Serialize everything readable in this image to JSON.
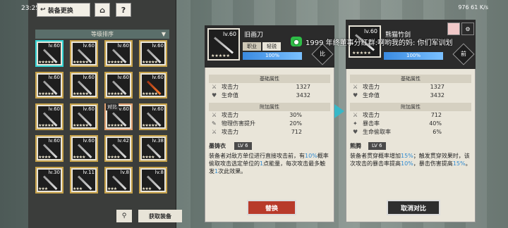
{
  "status": {
    "time": "23:25",
    "right_text": "976 61 K/s"
  },
  "nav": {
    "back_label": "装备更换",
    "home_glyph": "⌂",
    "help_glyph": "?"
  },
  "sort": {
    "label": "等级排序",
    "arrow": "▼"
  },
  "grid": [
    {
      "lv": "lv.60",
      "style": "sel",
      "blade": "grey",
      "stars": "★★★★★",
      "lock": ""
    },
    {
      "lv": "lv.60",
      "style": "gold",
      "blade": "grey",
      "stars": "★★★★★",
      "lock": ""
    },
    {
      "lv": "lv.60",
      "style": "gold",
      "blade": "grey",
      "stars": "★★★★★",
      "lock": ""
    },
    {
      "lv": "lv.60",
      "style": "gold",
      "blade": "grey",
      "stars": "★★★★★",
      "lock": ""
    },
    {
      "lv": "lv.60",
      "style": "gold",
      "blade": "grey",
      "stars": "★★★★★",
      "lock": ""
    },
    {
      "lv": "lv.60",
      "style": "gold",
      "blade": "grey",
      "stars": "★★★★★",
      "lock": ""
    },
    {
      "lv": "lv.60",
      "style": "gold",
      "blade": "grey",
      "stars": "★★★★★",
      "lock": ""
    },
    {
      "lv": "lv.60",
      "style": "gold",
      "blade": "red",
      "stars": "★★★★★",
      "lock": ""
    },
    {
      "lv": "lv.60",
      "style": "gold",
      "blade": "grey",
      "stars": "★★★★★",
      "lock": ""
    },
    {
      "lv": "lv.60",
      "style": "gold",
      "blade": "grey",
      "stars": "★★★★★",
      "lock": ""
    },
    {
      "lv": "lv.60",
      "style": "cmp",
      "blade": "grey",
      "stars": "★★★★★",
      "lock": ""
    },
    {
      "lv": "lv.60",
      "style": "gold",
      "blade": "grey",
      "stars": "★★★★★",
      "lock": ""
    },
    {
      "lv": "lv.60",
      "style": "gold",
      "blade": "grey",
      "stars": "★★★★",
      "lock": ""
    },
    {
      "lv": "lv.60",
      "style": "gold",
      "blade": "grey",
      "stars": "★★★★",
      "lock": ""
    },
    {
      "lv": "lv.42",
      "style": "gold",
      "blade": "grey",
      "stars": "★★★★",
      "lock": ""
    },
    {
      "lv": "lv.38",
      "style": "gold",
      "blade": "grey",
      "stars": "★★★★",
      "lock": ""
    },
    {
      "lv": "lv.30",
      "style": "gold",
      "blade": "grey",
      "stars": "★★★",
      "lock": ""
    },
    {
      "lv": "lv.11",
      "style": "gold",
      "blade": "grey",
      "stars": "★★★",
      "lock": ""
    },
    {
      "lv": "lv.8",
      "style": "gold",
      "blade": "grey",
      "stars": "★★★",
      "lock": ""
    },
    {
      "lv": "lv.8",
      "style": "gold",
      "blade": "grey",
      "stars": "★★★",
      "lock": ""
    }
  ],
  "compare_tag": "对比",
  "bottom": {
    "filter_glyph": "⚲",
    "obtain_label": "获取装备"
  },
  "left_weapon": {
    "lv": "lv.60",
    "name": "旧画刀",
    "type": "职业",
    "trait": "轻锐",
    "progress_text": "100%",
    "progress": 1.0,
    "side": "比",
    "base_title": "基础属性",
    "base": [
      {
        "icon": "⚔",
        "label": "攻击力",
        "value": "1327"
      },
      {
        "icon": "♥",
        "label": "生命值",
        "value": "3432"
      }
    ],
    "extra_title": "附加属性",
    "extra": [
      {
        "icon": "⚔",
        "label": "攻击力",
        "value": "30%"
      },
      {
        "icon": "✎",
        "label": "物理伤害提升",
        "value": "20%"
      },
      {
        "icon": "⚔",
        "label": "攻击力",
        "value": "712"
      }
    ],
    "skill_name": "墨铸衣",
    "skill_lv": "LV 6",
    "skill_desc": "装备者对敌方单位进行直接攻击前，有10%概率偷取攻击选定单位的1点能量，每次攻击最多触发1次此效果。",
    "action": "替换"
  },
  "right_weapon": {
    "lv": "lv.60",
    "name": "熊猫竹剑",
    "progress_text": "100%",
    "progress": 1.0,
    "side": "前",
    "base_title": "基础属性",
    "base": [
      {
        "icon": "⚔",
        "label": "攻击力",
        "value": "1327"
      },
      {
        "icon": "♥",
        "label": "生命值",
        "value": "3432"
      }
    ],
    "extra_title": "附加属性",
    "extra": [
      {
        "icon": "⚔",
        "label": "攻击力",
        "value": "712"
      },
      {
        "icon": "✦",
        "label": "暴击率",
        "value": "40%"
      },
      {
        "icon": "♥",
        "label": "生命偷取率",
        "value": "6%"
      }
    ],
    "skill_name": "熊腾",
    "skill_lv": "LV 6",
    "skill_desc": "装备者贯穿概率增加15%；触发贯穿效果时，该次攻击的暴击率提高10%，暴击伤害提高15%。",
    "action": "取消对比"
  },
  "notification": {
    "app_glyph": "●",
    "text": "1999 年终董事分红群:啊哟我的妈: 你们军训划"
  }
}
